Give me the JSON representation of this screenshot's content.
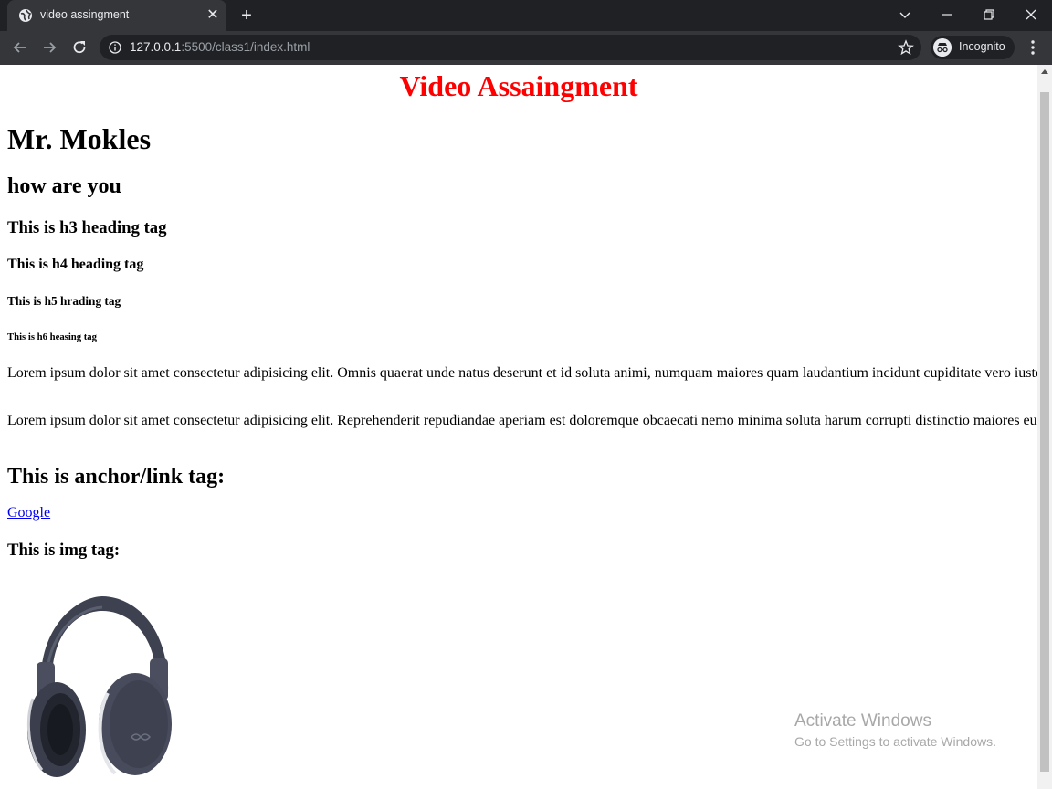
{
  "browser": {
    "tab": {
      "title": "video assingment",
      "close": "✕"
    },
    "new_tab": "+",
    "address": {
      "host": "127.0.0.1",
      "rest": ":5500/class1/index.html"
    },
    "profile_label": "Incognito"
  },
  "page": {
    "title": "Video Assaingment",
    "h1": "Mr. Mokles",
    "h2": "how are you",
    "h3": "This is h3 heading tag",
    "h4": "This is h4 heading tag",
    "h5": "This is h5 hrading tag",
    "h6": "This is h6 heasing tag",
    "paragraph1": "Lorem ipsum dolor sit amet consectetur adipisicing elit. Omnis quaerat unde natus deserunt et id soluta animi, numquam maiores quam laudantium incidunt cupiditate vero iusto asperiores fugit. Vel, omnis veritati.",
    "paragraph2": "Lorem ipsum dolor sit amet consectetur adipisicing elit. Reprehenderit repudiandae aperiam est doloremque obcaecati nemo minima soluta harum corrupti distinctio maiores eum aspernatur sequi saepe officiis fuga illum, ipsa quos.",
    "anchor_heading": "This is anchor/link tag:",
    "link_text": "Google",
    "img_heading": "This is img tag:"
  },
  "watermark": {
    "line1": "Activate Windows",
    "line2": "Go to Settings to activate Windows."
  },
  "colors": {
    "title": "#ff0000",
    "link": "#0000ee",
    "chrome_dark": "#202124",
    "chrome_toolbar": "#35363a"
  }
}
